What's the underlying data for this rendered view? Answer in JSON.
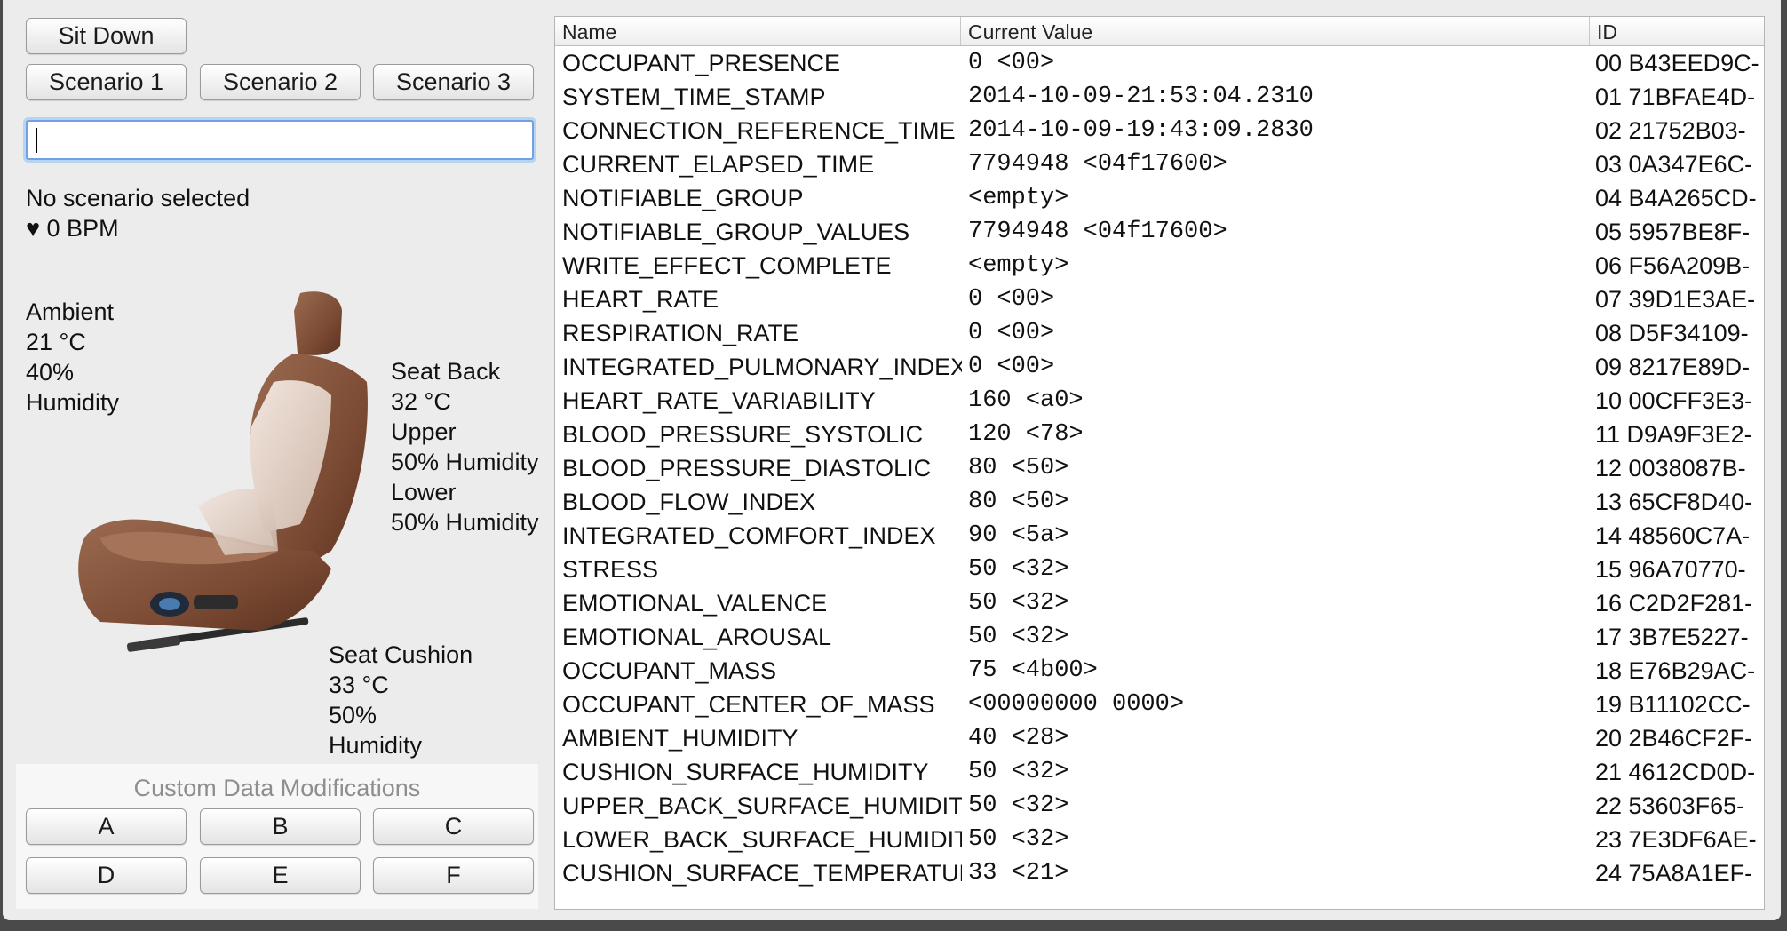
{
  "controls": {
    "sit_down": "Sit Down",
    "scenarios": [
      "Scenario 1",
      "Scenario 2",
      "Scenario 3"
    ],
    "search_value": ""
  },
  "status": {
    "scenario": "No scenario selected",
    "heart": "♥ 0 BPM"
  },
  "ambient": [
    "Ambient",
    "21 °C",
    "40%",
    "Humidity"
  ],
  "seat_back": [
    "Seat Back",
    "32 °C",
    "Upper",
    "50% Humidity",
    "Lower",
    "50% Humidity"
  ],
  "seat_cushion": [
    "Seat Cushion",
    "33 °C",
    "50%",
    "Humidity"
  ],
  "custom": {
    "title": "Custom Data Modifications",
    "buttons": [
      "A",
      "B",
      "C",
      "D",
      "E",
      "F"
    ]
  },
  "table": {
    "headers": [
      "Name",
      "Current Value",
      "ID"
    ],
    "rows": [
      [
        "OCCUPANT_PRESENCE",
        "0 <00>",
        "00 B43EED9C-"
      ],
      [
        "SYSTEM_TIME_STAMP",
        "2014-10-09-21:53:04.2310",
        "01 71BFAE4D-"
      ],
      [
        "CONNECTION_REFERENCE_TIME",
        "2014-10-09-19:43:09.2830",
        "02 21752B03-"
      ],
      [
        "CURRENT_ELAPSED_TIME",
        "7794948 <04f17600>",
        "03 0A347E6C-"
      ],
      [
        "NOTIFIABLE_GROUP",
        "<empty>",
        "04 B4A265CD-"
      ],
      [
        "NOTIFIABLE_GROUP_VALUES",
        "7794948 <04f17600>",
        "05 5957BE8F-"
      ],
      [
        "WRITE_EFFECT_COMPLETE",
        "<empty>",
        "06 F56A209B-"
      ],
      [
        "HEART_RATE",
        "0 <00>",
        "07 39D1E3AE-"
      ],
      [
        "RESPIRATION_RATE",
        "0 <00>",
        "08 D5F34109-"
      ],
      [
        "INTEGRATED_PULMONARY_INDEX",
        "0 <00>",
        "09 8217E89D-"
      ],
      [
        "HEART_RATE_VARIABILITY",
        "160 <a0>",
        "10 00CFF3E3-"
      ],
      [
        "BLOOD_PRESSURE_SYSTOLIC",
        "120 <78>",
        "11 D9A9F3E2-"
      ],
      [
        "BLOOD_PRESSURE_DIASTOLIC",
        "80 <50>",
        "12 0038087B-"
      ],
      [
        "BLOOD_FLOW_INDEX",
        "80 <50>",
        "13 65CF8D40-"
      ],
      [
        "INTEGRATED_COMFORT_INDEX",
        "90 <5a>",
        "14 48560C7A-"
      ],
      [
        "STRESS",
        "50 <32>",
        "15 96A70770-"
      ],
      [
        "EMOTIONAL_VALENCE",
        "50 <32>",
        "16 C2D2F281-"
      ],
      [
        "EMOTIONAL_AROUSAL",
        "50 <32>",
        "17 3B7E5227-"
      ],
      [
        "OCCUPANT_MASS",
        "75 <4b00>",
        "18 E76B29AC-"
      ],
      [
        "OCCUPANT_CENTER_OF_MASS",
        "<00000000 0000>",
        "19 B11102CC-"
      ],
      [
        "AMBIENT_HUMIDITY",
        "40 <28>",
        "20 2B46CF2F-"
      ],
      [
        "CUSHION_SURFACE_HUMIDITY",
        "50 <32>",
        "21 4612CD0D-"
      ],
      [
        "UPPER_BACK_SURFACE_HUMIDITY",
        "50 <32>",
        "22 53603F65-"
      ],
      [
        "LOWER_BACK_SURFACE_HUMIDITY",
        "50 <32>",
        "23 7E3DF6AE-"
      ],
      [
        "CUSHION_SURFACE_TEMPERATURE",
        "33 <21>",
        "24 75A8A1EF-"
      ]
    ]
  }
}
